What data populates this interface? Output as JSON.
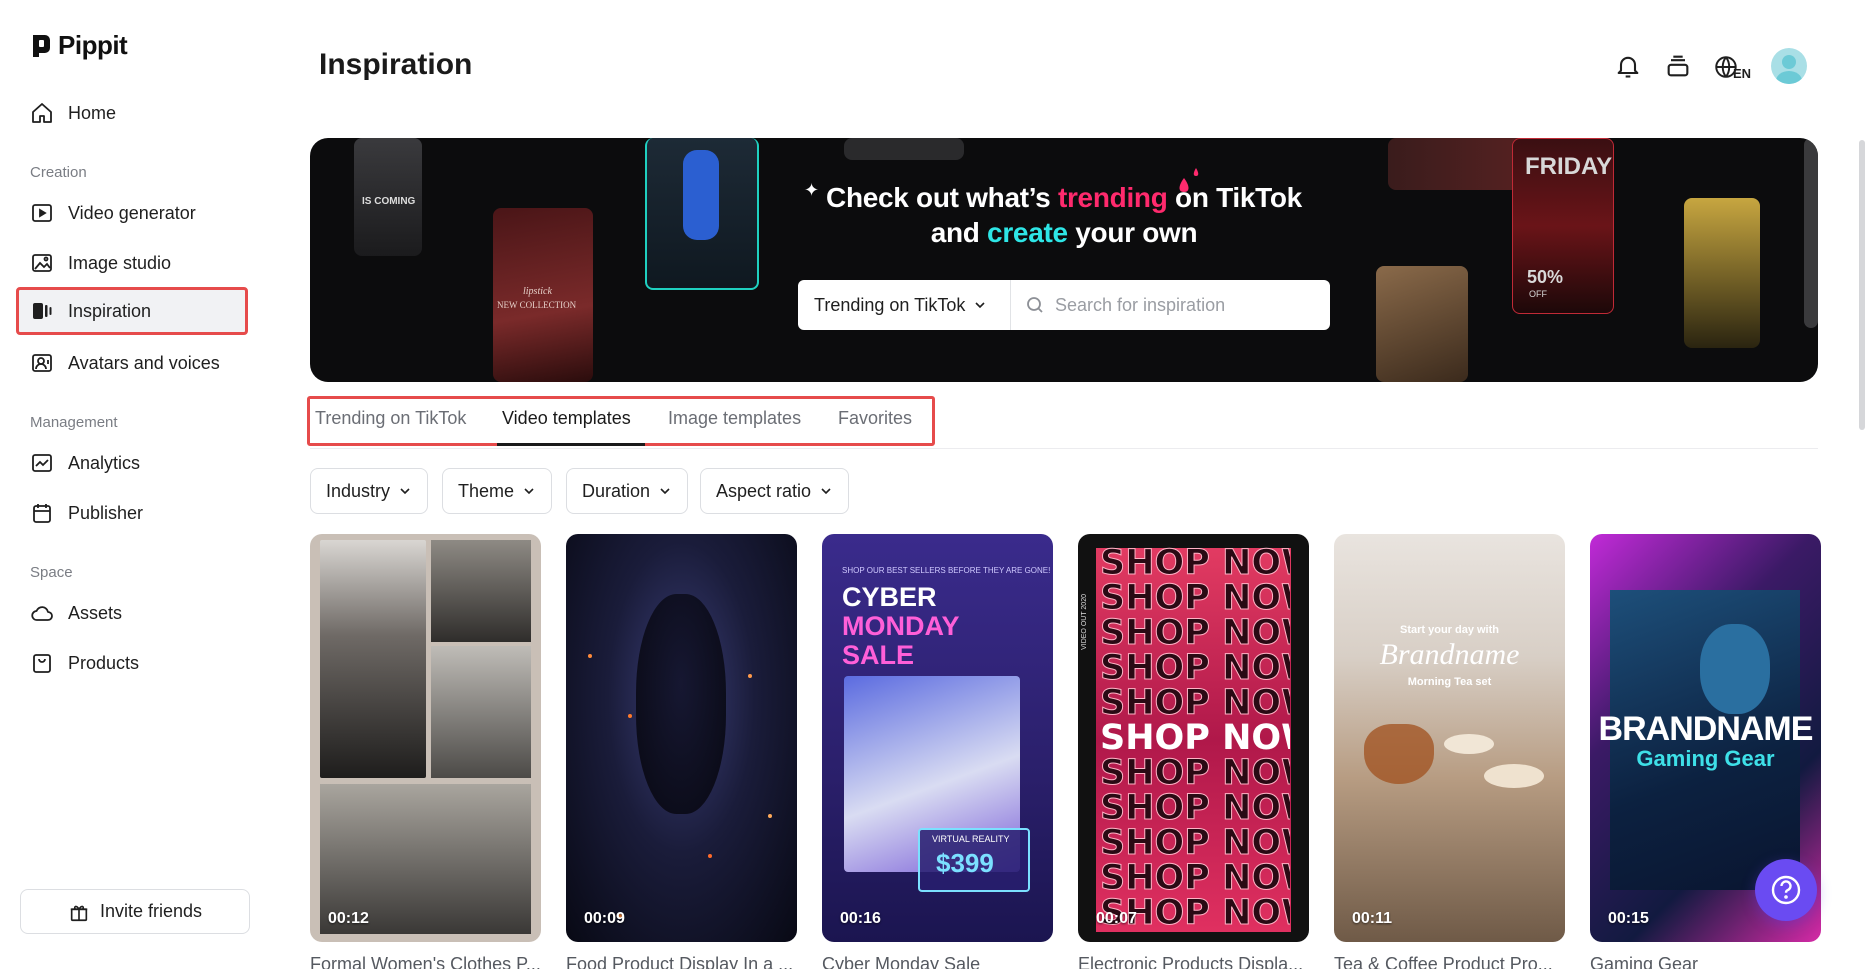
{
  "app": {
    "name": "Pippit"
  },
  "sidebar": {
    "home": "Home",
    "sections": [
      "Creation",
      "Management",
      "Space"
    ],
    "creation": [
      "Video generator",
      "Image studio",
      "Inspiration",
      "Avatars and voices"
    ],
    "management": [
      "Analytics",
      "Publisher"
    ],
    "space": [
      "Assets",
      "Products"
    ],
    "active_item": "Inspiration",
    "invite": "Invite friends"
  },
  "header": {
    "title": "Inspiration",
    "language": "EN"
  },
  "banner": {
    "line1_part1": "Check out what’s ",
    "line1_highlight": "trending",
    "line1_part2": " on TikTok",
    "line2_part1": "and ",
    "line2_highlight": "create",
    "line2_part2": " your own",
    "select_value": "Trending on TikTok",
    "search_placeholder": "Search for inspiration",
    "deco_texts": [
      "IS COMING",
      "lipstick",
      "NEW COLLECTION",
      "FRIDAY",
      "50%",
      "OFF"
    ]
  },
  "tabs": [
    {
      "label": "Trending on TikTok",
      "active": false
    },
    {
      "label": "Video templates",
      "active": true
    },
    {
      "label": "Image templates",
      "active": false
    },
    {
      "label": "Favorites",
      "active": false
    }
  ],
  "filters": [
    "Industry",
    "Theme",
    "Duration",
    "Aspect ratio"
  ],
  "cards": [
    {
      "title": "Formal Women's Clothes P...",
      "duration": "00:12"
    },
    {
      "title": "Food Product Display In a ...",
      "duration": "00:09"
    },
    {
      "title": "Cyber Monday Sale",
      "duration": "00:16"
    },
    {
      "title": "Electronic Products Displa...",
      "duration": "00:07"
    },
    {
      "title": "Tea & Coffee Product Pro...",
      "duration": "00:11"
    },
    {
      "title": "Gaming Gear",
      "duration": "00:15"
    }
  ],
  "card_texts": {
    "cyber_small": "SHOP OUR BEST SELLERS BEFORE THEY ARE GONE!",
    "cyber_1": "CYBER",
    "cyber_2": "MONDAY",
    "cyber_3": "SALE",
    "cyber_vr": "VIRTUAL REALITY",
    "cyber_price": "$399",
    "shop_now": "SHOP NOW",
    "shop_side_1": "VIDEO OUT 2020",
    "tea_1": "Start your day with",
    "tea_2": "Brandname",
    "tea_3": "Morning Tea set",
    "gaming_1": "BRANDNAME",
    "gaming_2": "Gaming Gear"
  },
  "colors": {
    "accent_red_outline": "#e64b4b",
    "trending_pink": "#ff2a6d",
    "create_cyan": "#2ee6e6",
    "help_purple": "#6a4bf2"
  }
}
